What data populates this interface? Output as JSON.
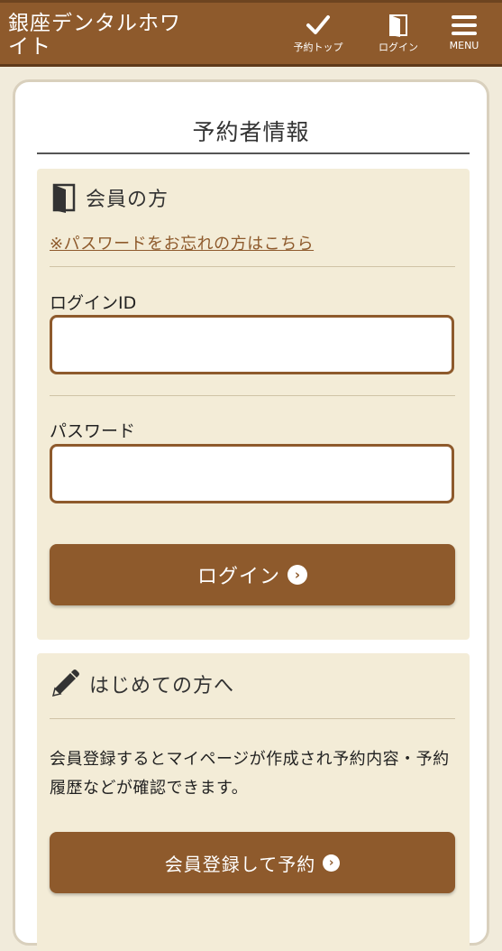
{
  "header": {
    "site_title": "銀座デンタルホワイト",
    "nav": [
      {
        "label": "予約トップ",
        "icon": "check-icon"
      },
      {
        "label": "ログイン",
        "icon": "door-icon"
      },
      {
        "label": "MENU",
        "icon": "hamburger-icon"
      }
    ]
  },
  "card": {
    "title": "予約者情報"
  },
  "member": {
    "heading": "会員の方",
    "forgot_password": "※パスワードをお忘れの方はこちら",
    "login_id_label": "ログインID",
    "login_id_value": "",
    "password_label": "パスワード",
    "password_value": "",
    "login_button": "ログイン"
  },
  "new_user": {
    "heading": "はじめての方へ",
    "description": "会員登録するとマイページが作成され予約内容・予約履歴などが確認できます。",
    "register_button": "会員登録して予約"
  },
  "colors": {
    "brand": "#8e5a2c",
    "panel_bg": "#f3ecd7",
    "page_bg": "#f1ebdb"
  }
}
